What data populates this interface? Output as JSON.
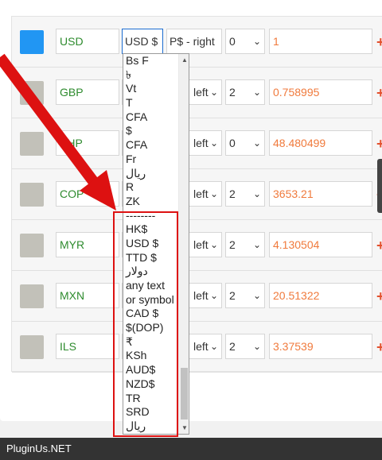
{
  "rows": [
    {
      "code": "USD",
      "symbol": "USD $",
      "position": "P$ - right",
      "decimals": "0",
      "rate": "1",
      "active": true
    },
    {
      "code": "GBP",
      "symbol": "",
      "position": "left",
      "decimals": "2",
      "rate": "0.758995"
    },
    {
      "code": "PHP",
      "symbol": "",
      "position": "left",
      "decimals": "0",
      "rate": "48.480499"
    },
    {
      "code": "COP",
      "symbol": "",
      "position": "left",
      "decimals": "2",
      "rate": "3653.21"
    },
    {
      "code": "MYR",
      "symbol": "",
      "position": "left",
      "decimals": "2",
      "rate": "4.130504"
    },
    {
      "code": "MXN",
      "symbol": "",
      "position": "left",
      "decimals": "2",
      "rate": "20.51322"
    },
    {
      "code": "ILS",
      "symbol": "",
      "position": "left",
      "decimals": "2",
      "rate": "3.37539"
    }
  ],
  "dropdown_options": [
    "Bs F",
    "৳",
    "Vt",
    "T",
    "CFA",
    "$",
    "CFA",
    "Fr",
    "ریال",
    "R",
    "ZK",
    "--------",
    "HK$",
    "USD $",
    "TTD $",
    "دولار",
    "any text",
    "or symbol",
    "CAD $",
    "$(DOP)",
    "₹",
    "KSh",
    "AUD$",
    "NZD$",
    "TR",
    "SRD",
    "ریال"
  ],
  "plus_label": "+",
  "chevron": "⌄",
  "footer": {
    "brand": "PluginUs.NET"
  },
  "colors": {
    "active_swatch": "#2196f3",
    "code_text": "#2e8b2e",
    "rate_text": "#f07a3c",
    "annotation_red": "#dd1111"
  }
}
